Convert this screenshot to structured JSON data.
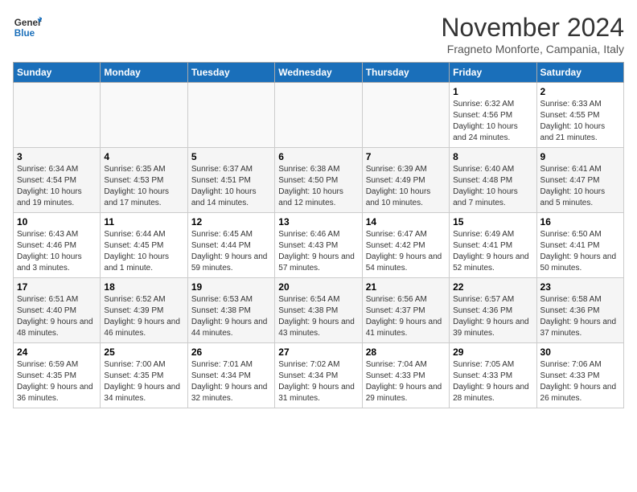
{
  "logo": {
    "line1": "General",
    "line2": "Blue"
  },
  "title": "November 2024",
  "location": "Fragneto Monforte, Campania, Italy",
  "weekdays": [
    "Sunday",
    "Monday",
    "Tuesday",
    "Wednesday",
    "Thursday",
    "Friday",
    "Saturday"
  ],
  "weeks": [
    [
      {
        "day": "",
        "info": ""
      },
      {
        "day": "",
        "info": ""
      },
      {
        "day": "",
        "info": ""
      },
      {
        "day": "",
        "info": ""
      },
      {
        "day": "",
        "info": ""
      },
      {
        "day": "1",
        "info": "Sunrise: 6:32 AM\nSunset: 4:56 PM\nDaylight: 10 hours and 24 minutes."
      },
      {
        "day": "2",
        "info": "Sunrise: 6:33 AM\nSunset: 4:55 PM\nDaylight: 10 hours and 21 minutes."
      }
    ],
    [
      {
        "day": "3",
        "info": "Sunrise: 6:34 AM\nSunset: 4:54 PM\nDaylight: 10 hours and 19 minutes."
      },
      {
        "day": "4",
        "info": "Sunrise: 6:35 AM\nSunset: 4:53 PM\nDaylight: 10 hours and 17 minutes."
      },
      {
        "day": "5",
        "info": "Sunrise: 6:37 AM\nSunset: 4:51 PM\nDaylight: 10 hours and 14 minutes."
      },
      {
        "day": "6",
        "info": "Sunrise: 6:38 AM\nSunset: 4:50 PM\nDaylight: 10 hours and 12 minutes."
      },
      {
        "day": "7",
        "info": "Sunrise: 6:39 AM\nSunset: 4:49 PM\nDaylight: 10 hours and 10 minutes."
      },
      {
        "day": "8",
        "info": "Sunrise: 6:40 AM\nSunset: 4:48 PM\nDaylight: 10 hours and 7 minutes."
      },
      {
        "day": "9",
        "info": "Sunrise: 6:41 AM\nSunset: 4:47 PM\nDaylight: 10 hours and 5 minutes."
      }
    ],
    [
      {
        "day": "10",
        "info": "Sunrise: 6:43 AM\nSunset: 4:46 PM\nDaylight: 10 hours and 3 minutes."
      },
      {
        "day": "11",
        "info": "Sunrise: 6:44 AM\nSunset: 4:45 PM\nDaylight: 10 hours and 1 minute."
      },
      {
        "day": "12",
        "info": "Sunrise: 6:45 AM\nSunset: 4:44 PM\nDaylight: 9 hours and 59 minutes."
      },
      {
        "day": "13",
        "info": "Sunrise: 6:46 AM\nSunset: 4:43 PM\nDaylight: 9 hours and 57 minutes."
      },
      {
        "day": "14",
        "info": "Sunrise: 6:47 AM\nSunset: 4:42 PM\nDaylight: 9 hours and 54 minutes."
      },
      {
        "day": "15",
        "info": "Sunrise: 6:49 AM\nSunset: 4:41 PM\nDaylight: 9 hours and 52 minutes."
      },
      {
        "day": "16",
        "info": "Sunrise: 6:50 AM\nSunset: 4:41 PM\nDaylight: 9 hours and 50 minutes."
      }
    ],
    [
      {
        "day": "17",
        "info": "Sunrise: 6:51 AM\nSunset: 4:40 PM\nDaylight: 9 hours and 48 minutes."
      },
      {
        "day": "18",
        "info": "Sunrise: 6:52 AM\nSunset: 4:39 PM\nDaylight: 9 hours and 46 minutes."
      },
      {
        "day": "19",
        "info": "Sunrise: 6:53 AM\nSunset: 4:38 PM\nDaylight: 9 hours and 44 minutes."
      },
      {
        "day": "20",
        "info": "Sunrise: 6:54 AM\nSunset: 4:38 PM\nDaylight: 9 hours and 43 minutes."
      },
      {
        "day": "21",
        "info": "Sunrise: 6:56 AM\nSunset: 4:37 PM\nDaylight: 9 hours and 41 minutes."
      },
      {
        "day": "22",
        "info": "Sunrise: 6:57 AM\nSunset: 4:36 PM\nDaylight: 9 hours and 39 minutes."
      },
      {
        "day": "23",
        "info": "Sunrise: 6:58 AM\nSunset: 4:36 PM\nDaylight: 9 hours and 37 minutes."
      }
    ],
    [
      {
        "day": "24",
        "info": "Sunrise: 6:59 AM\nSunset: 4:35 PM\nDaylight: 9 hours and 36 minutes."
      },
      {
        "day": "25",
        "info": "Sunrise: 7:00 AM\nSunset: 4:35 PM\nDaylight: 9 hours and 34 minutes."
      },
      {
        "day": "26",
        "info": "Sunrise: 7:01 AM\nSunset: 4:34 PM\nDaylight: 9 hours and 32 minutes."
      },
      {
        "day": "27",
        "info": "Sunrise: 7:02 AM\nSunset: 4:34 PM\nDaylight: 9 hours and 31 minutes."
      },
      {
        "day": "28",
        "info": "Sunrise: 7:04 AM\nSunset: 4:33 PM\nDaylight: 9 hours and 29 minutes."
      },
      {
        "day": "29",
        "info": "Sunrise: 7:05 AM\nSunset: 4:33 PM\nDaylight: 9 hours and 28 minutes."
      },
      {
        "day": "30",
        "info": "Sunrise: 7:06 AM\nSunset: 4:33 PM\nDaylight: 9 hours and 26 minutes."
      }
    ]
  ]
}
